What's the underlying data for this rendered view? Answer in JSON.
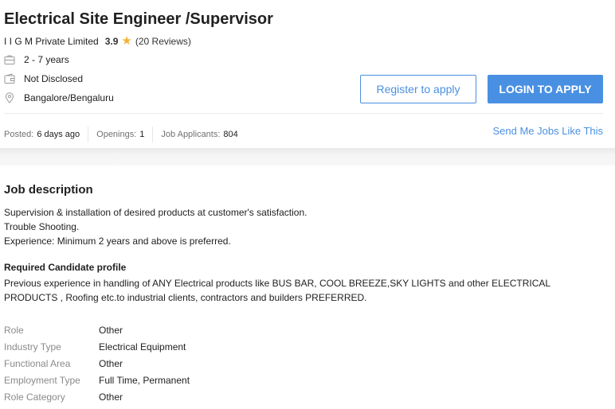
{
  "job": {
    "title": "Electrical Site Engineer /Supervisor",
    "company": "I I G M Private Limited",
    "rating": "3.9",
    "reviews": "(20 Reviews)",
    "experience": "2 - 7 years",
    "salary": "Not Disclosed",
    "location": "Bangalore/Bengaluru"
  },
  "actions": {
    "register_label": "Register to apply",
    "login_label": "LOGIN TO APPLY",
    "send_jobs_label": "Send Me Jobs Like This"
  },
  "stats": {
    "posted_label": "Posted:",
    "posted_value": "6 days ago",
    "openings_label": "Openings:",
    "openings_value": "1",
    "applicants_label": "Job Applicants:",
    "applicants_value": "804"
  },
  "description": {
    "heading": "Job description",
    "lines": [
      "Supervision & installation of desired products at customer's satisfaction.",
      "Trouble Shooting.",
      "Experience: Minimum 2 years and above is preferred."
    ],
    "required_heading": "Required Candidate profile",
    "required_text": "Previous experience in handling of ANY Electrical products like BUS BAR, COOL BREEZE,SKY LIGHTS and other ELECTRICAL PRODUCTS , Roofing etc.to industrial clients, contractors and builders PREFERRED."
  },
  "details": [
    {
      "label": "Role",
      "value": "Other"
    },
    {
      "label": "Industry Type",
      "value": "Electrical Equipment"
    },
    {
      "label": "Functional Area",
      "value": "Other"
    },
    {
      "label": "Employment Type",
      "value": "Full Time, Permanent"
    },
    {
      "label": "Role Category",
      "value": "Other"
    }
  ],
  "icons": {
    "star": "star-icon",
    "experience": "briefcase-icon",
    "salary": "wallet-icon",
    "location": "location-pin-icon"
  },
  "colors": {
    "accent": "#4a90e2",
    "star": "#f3b23a",
    "label_gray": "#8a8a8a"
  }
}
